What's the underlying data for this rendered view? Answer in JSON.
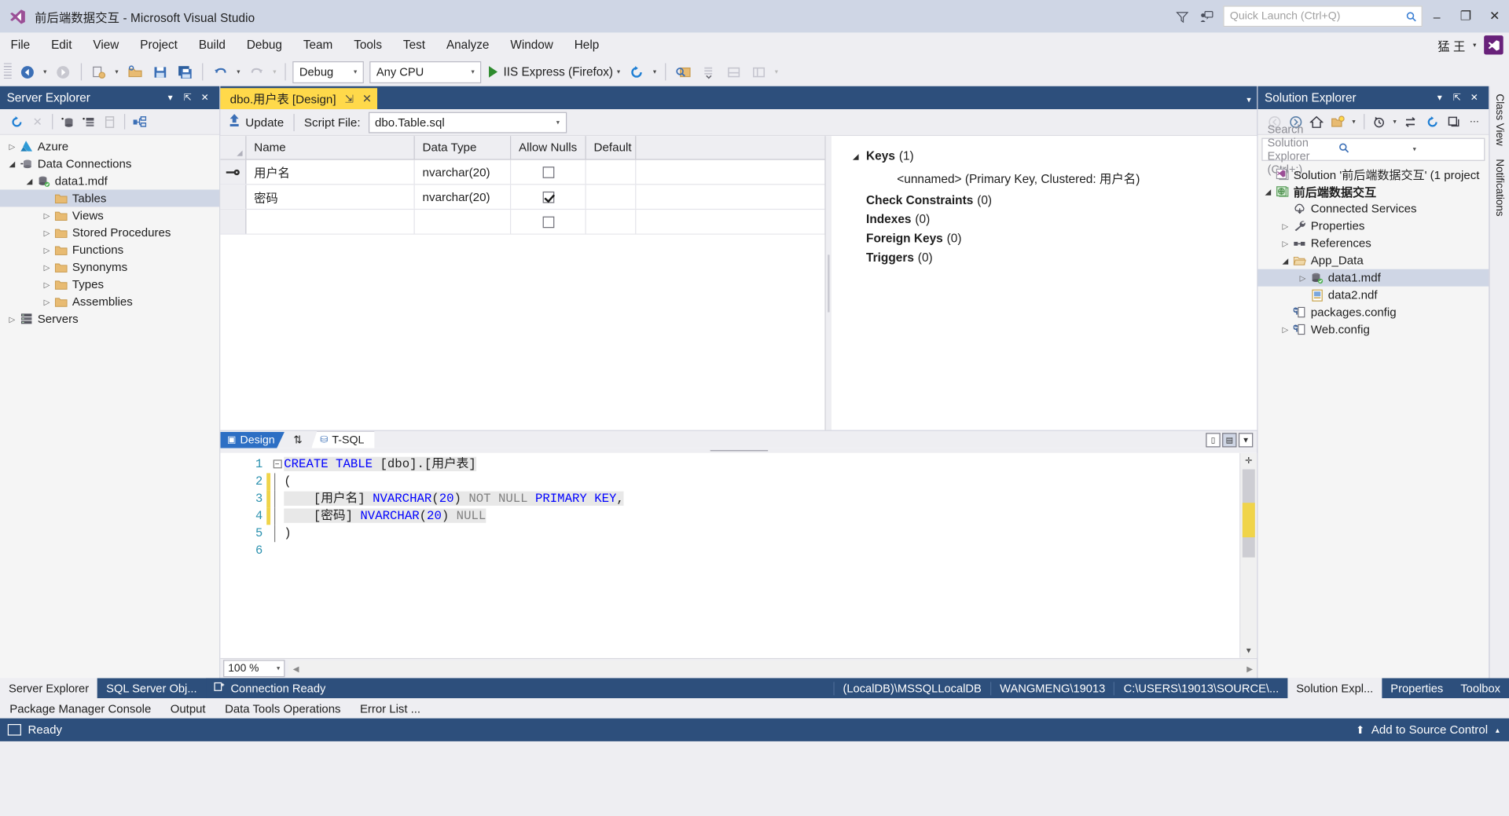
{
  "titlebar": {
    "title": "前后端数据交互 - Microsoft Visual Studio",
    "logo_icon": "visual-studio-logo",
    "feedback_icon": "funnel-icon",
    "feedback2_icon": "send-feedback-icon",
    "quick_launch_placeholder": "Quick Launch (Ctrl+Q)",
    "search_icon": "search-icon",
    "minimize": "–",
    "maximize": "❐",
    "close": "✕"
  },
  "menubar": {
    "items": [
      "File",
      "Edit",
      "View",
      "Project",
      "Build",
      "Debug",
      "Team",
      "Tools",
      "Test",
      "Analyze",
      "Window",
      "Help"
    ],
    "account": "猛 王",
    "account_caret": "▾",
    "badge": "⬢"
  },
  "toolbar": {
    "nav_back_icon": "navigate-back-icon",
    "nav_forward_icon": "navigate-forward-icon",
    "new_project_icon": "new-project-icon",
    "open_file_icon": "open-file-icon",
    "save_icon": "save-icon",
    "save_all_icon": "save-all-icon",
    "undo_icon": "undo-icon",
    "redo_icon": "redo-icon",
    "config": "Debug",
    "platform": "Any CPU",
    "run_label": "IIS Express (Firefox)",
    "refresh_icon": "refresh-icon",
    "find_icon": "find-in-files-icon",
    "step_icon": "step-icon",
    "panel_icon1": "panel-icon",
    "panel_icon2": "panel-icon-2",
    "caret": "▾"
  },
  "server_explorer": {
    "title": "Server Explorer",
    "dropdown_icon": "chevron-down-icon",
    "pin_icon": "pin-icon",
    "close_icon": "close-icon",
    "tools": [
      "refresh-icon",
      "delete-icon",
      "connect-database-icon",
      "add-server-icon",
      "properties-icon",
      "object-diagram-icon"
    ],
    "tree": [
      {
        "label": "Azure",
        "indent": 0,
        "arrow": "▷",
        "icon": "azure-icon",
        "selected": false
      },
      {
        "label": "Data Connections",
        "indent": 0,
        "arrow": "◢",
        "icon": "data-connections-icon",
        "selected": false
      },
      {
        "label": "data1.mdf",
        "indent": 1,
        "arrow": "◢",
        "icon": "database-icon",
        "selected": false
      },
      {
        "label": "Tables",
        "indent": 2,
        "arrow": "",
        "icon": "folder-icon",
        "selected": true
      },
      {
        "label": "Views",
        "indent": 2,
        "arrow": "▷",
        "icon": "folder-icon",
        "selected": false
      },
      {
        "label": "Stored Procedures",
        "indent": 2,
        "arrow": "▷",
        "icon": "folder-icon",
        "selected": false
      },
      {
        "label": "Functions",
        "indent": 2,
        "arrow": "▷",
        "icon": "folder-icon",
        "selected": false
      },
      {
        "label": "Synonyms",
        "indent": 2,
        "arrow": "▷",
        "icon": "folder-icon",
        "selected": false
      },
      {
        "label": "Types",
        "indent": 2,
        "arrow": "▷",
        "icon": "folder-icon",
        "selected": false
      },
      {
        "label": "Assemblies",
        "indent": 2,
        "arrow": "▷",
        "icon": "folder-icon",
        "selected": false
      },
      {
        "label": "Servers",
        "indent": 0,
        "arrow": "▷",
        "icon": "servers-icon",
        "selected": false
      }
    ]
  },
  "document": {
    "tab_label": "dbo.用户表 [Design]",
    "tab_pin": "⇲",
    "tab_close": "✕",
    "tabstrip_caret": "▾",
    "update_label": "Update",
    "update_icon": "update-arrow-icon",
    "script_file_label": "Script File:",
    "script_file_value": "dbo.Table.sql",
    "caret": "▾"
  },
  "grid": {
    "columns": [
      "Name",
      "Data Type",
      "Allow Nulls",
      "Default"
    ],
    "rows": [
      {
        "key": true,
        "name": "用户名",
        "type": "nvarchar(20)",
        "allow_nulls": false,
        "default": ""
      },
      {
        "key": false,
        "name": "密码",
        "type": "nvarchar(20)",
        "allow_nulls": true,
        "default": ""
      },
      {
        "key": false,
        "name": "",
        "type": "",
        "allow_nulls": false,
        "default": ""
      }
    ]
  },
  "keys_pane": {
    "keys_label": "Keys",
    "keys_count": "(1)",
    "keys_arrow": "◢",
    "key_item": "<unnamed>   (Primary Key, Clustered: 用户名)",
    "check_constraints_label": "Check Constraints",
    "check_constraints_count": "(0)",
    "indexes_label": "Indexes",
    "indexes_count": "(0)",
    "foreign_keys_label": "Foreign Keys",
    "foreign_keys_count": "(0)",
    "triggers_label": "Triggers",
    "triggers_count": "(0)"
  },
  "editor": {
    "tab_design": "Design",
    "tab_design_icon": "design-view-icon",
    "swap_icon": "swap-panes-icon",
    "tab_tsql": "T-SQL",
    "tab_tsql_icon": "tsql-icon",
    "win_split_icon": "split-horizontal-icon",
    "win_split_icon2": "split-vertical-icon",
    "win_maximize_icon": "maximize-pane-icon",
    "zoom": "100 %",
    "zoom_caret": "▾",
    "line_numbers": [
      "1",
      "2",
      "3",
      "4",
      "5",
      "6"
    ],
    "code_lines": [
      [
        {
          "t": "CREATE TABLE ",
          "c": "kw"
        },
        {
          "t": "[dbo]",
          "c": "pl"
        },
        {
          "t": ".",
          "c": "pl"
        },
        {
          "t": "[用户表]",
          "c": "pl"
        }
      ],
      [
        {
          "t": "(",
          "c": "pl"
        }
      ],
      [
        {
          "t": "    [用户名] ",
          "c": "pl"
        },
        {
          "t": "NVARCHAR",
          "c": "kw"
        },
        {
          "t": "(",
          "c": "pl"
        },
        {
          "t": "20",
          "c": "num"
        },
        {
          "t": ") ",
          "c": "pl"
        },
        {
          "t": "NOT NULL ",
          "c": "gray"
        },
        {
          "t": "PRIMARY KEY",
          "c": "kw"
        },
        {
          "t": ",",
          "c": "pl"
        }
      ],
      [
        {
          "t": "    [密码] ",
          "c": "pl"
        },
        {
          "t": "NVARCHAR",
          "c": "kw"
        },
        {
          "t": "(",
          "c": "pl"
        },
        {
          "t": "20",
          "c": "num"
        },
        {
          "t": ") ",
          "c": "pl"
        },
        {
          "t": "NULL",
          "c": "gray"
        }
      ],
      [
        {
          "t": ")",
          "c": "pl"
        }
      ],
      [
        {
          "t": "",
          "c": "pl"
        }
      ]
    ]
  },
  "solution_explorer": {
    "title": "Solution Explorer",
    "dropdown_icon": "chevron-down-icon",
    "pin_icon": "pin-icon",
    "close_icon": "close-icon",
    "tools": [
      "back-icon",
      "forward-icon",
      "home-icon",
      "new-folder-icon",
      "pending-changes-icon",
      "sync-icon",
      "refresh-icon",
      "collapse-all-icon",
      "overflow-icon"
    ],
    "search_placeholder": "Search Solution Explorer (Ctrl+;)",
    "search_icon": "search-icon",
    "search_caret": "▾",
    "tree": [
      {
        "label": "Solution '前后端数据交互' (1 project",
        "indent": 0,
        "arrow": "",
        "icon": "solution-icon",
        "selected": false,
        "bold": false
      },
      {
        "label": "前后端数据交互",
        "indent": 0,
        "arrow": "◢",
        "icon": "project-icon",
        "selected": false,
        "bold": true
      },
      {
        "label": "Connected Services",
        "indent": 1,
        "arrow": "",
        "icon": "connected-services-icon",
        "selected": false,
        "bold": false
      },
      {
        "label": "Properties",
        "indent": 1,
        "arrow": "▷",
        "icon": "wrench-icon",
        "selected": false,
        "bold": false
      },
      {
        "label": "References",
        "indent": 1,
        "arrow": "▷",
        "icon": "references-icon",
        "selected": false,
        "bold": false
      },
      {
        "label": "App_Data",
        "indent": 1,
        "arrow": "◢",
        "icon": "folder-open-icon",
        "selected": false,
        "bold": false
      },
      {
        "label": "data1.mdf",
        "indent": 2,
        "arrow": "▷",
        "icon": "database-icon",
        "selected": true,
        "bold": false
      },
      {
        "label": "data2.ndf",
        "indent": 2,
        "arrow": "",
        "icon": "ndf-file-icon",
        "selected": false,
        "bold": false
      },
      {
        "label": "packages.config",
        "indent": 1,
        "arrow": "",
        "icon": "config-file-icon",
        "selected": false,
        "bold": false
      },
      {
        "label": "Web.config",
        "indent": 1,
        "arrow": "▷",
        "icon": "config-file-icon",
        "selected": false,
        "bold": false
      }
    ]
  },
  "right_strip": {
    "items": [
      "Class View",
      "Notifications"
    ]
  },
  "dock": {
    "left_tabs": [
      {
        "label": "Server Explorer",
        "active": true
      },
      {
        "label": "SQL Server Obj...",
        "active": false
      }
    ],
    "right_tabs": [
      {
        "label": "Solution Expl...",
        "active": true
      },
      {
        "label": "Properties",
        "active": false
      },
      {
        "label": "Toolbox",
        "active": false
      }
    ],
    "connection_status": "Connection Ready",
    "connection_icon": "connection-icon",
    "status_cells": [
      "(LocalDB)\\MSSQLLocalDB",
      "WANGMENG\\19013",
      "C:\\USERS\\19013\\SOURCE\\..."
    ]
  },
  "second_dock": {
    "items": [
      "Package Manager Console",
      "Output",
      "Data Tools Operations",
      "Error List ..."
    ]
  },
  "statusbar": {
    "ready": "Ready",
    "ready_icon": "status-box-icon",
    "source_control": "Add to Source Control",
    "up_icon": "⬆",
    "caret": "▴"
  },
  "colors": {
    "accent_blue": "#2d4f7c",
    "tab_yellow": "#ffd94a",
    "title_bg": "#cfd6e5",
    "chrome": "#eeeef2"
  }
}
